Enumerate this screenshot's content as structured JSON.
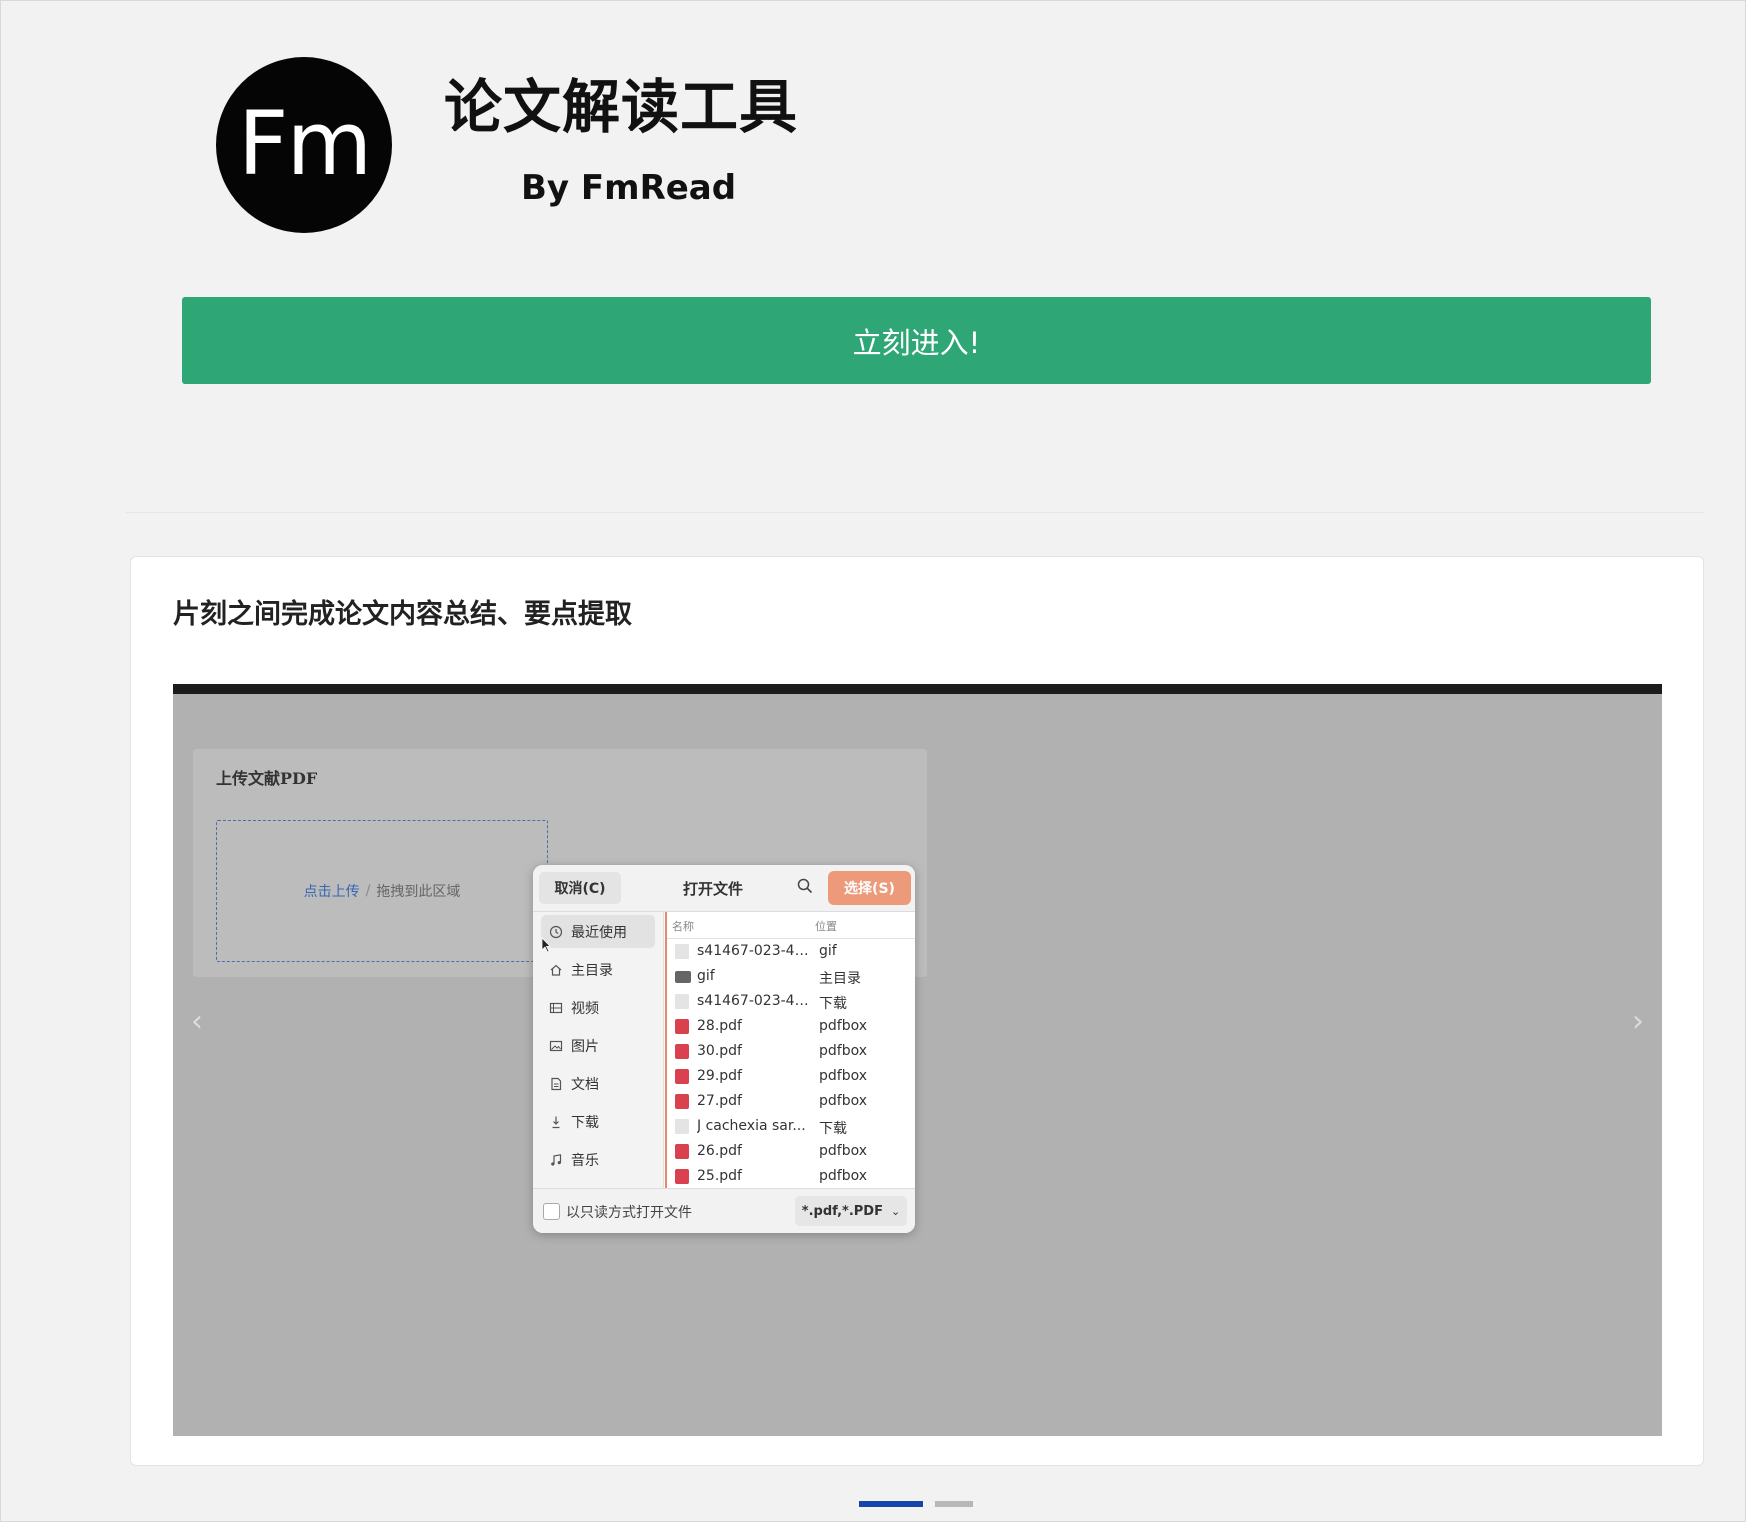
{
  "header": {
    "logo_text": "Fm",
    "title": "论文解读工具",
    "subtitle": "By FmRead"
  },
  "enter_button": {
    "label": "立刻进入!"
  },
  "feature_card": {
    "title": "片刻之间完成论文内容总结、要点提取"
  },
  "carousel": {
    "upload_panel": {
      "title": "上传文献PDF",
      "click_upload": "点击上传",
      "separator": "/",
      "drag_text": "拖拽到此区域"
    },
    "file_dialog": {
      "cancel_label": "取消(C)",
      "title": "打开文件",
      "select_label": "选择(S)",
      "sidebar": [
        {
          "label": "最近使用",
          "icon": "clock-icon",
          "active": true
        },
        {
          "label": "主目录",
          "icon": "home-icon"
        },
        {
          "label": "视频",
          "icon": "film-icon"
        },
        {
          "label": "图片",
          "icon": "image-icon"
        },
        {
          "label": "文档",
          "icon": "document-icon"
        },
        {
          "label": "下载",
          "icon": "download-icon"
        },
        {
          "label": "音乐",
          "icon": "music-icon"
        }
      ],
      "columns": {
        "name": "名称",
        "location": "位置"
      },
      "files": [
        {
          "name": "s41467-023-42...",
          "location": "gif",
          "type": "doc"
        },
        {
          "name": "gif",
          "location": "主目录",
          "type": "folder"
        },
        {
          "name": "s41467-023-42...",
          "location": "下载",
          "type": "doc"
        },
        {
          "name": "28.pdf",
          "location": "pdfbox",
          "type": "pdf"
        },
        {
          "name": "30.pdf",
          "location": "pdfbox",
          "type": "pdf"
        },
        {
          "name": "29.pdf",
          "location": "pdfbox",
          "type": "pdf"
        },
        {
          "name": "27.pdf",
          "location": "pdfbox",
          "type": "pdf"
        },
        {
          "name": "J cachexia sar...",
          "location": "下载",
          "type": "doc"
        },
        {
          "name": "26.pdf",
          "location": "pdfbox",
          "type": "pdf"
        },
        {
          "name": "25.pdf",
          "location": "pdfbox",
          "type": "pdf"
        }
      ],
      "readonly_label": "以只读方式打开文件",
      "filter_value": "*.pdf,*.PDF"
    },
    "slide_count": 2,
    "active_slide": 1
  },
  "colors": {
    "accent_green": "#2ea676",
    "select_button": "#ec9a7a",
    "indicator_active": "#1246a8",
    "indicator_inactive": "#b8b8b8"
  }
}
